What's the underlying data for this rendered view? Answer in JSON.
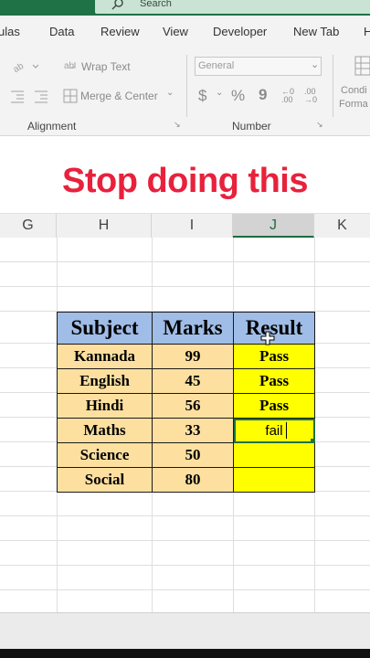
{
  "search": {
    "placeholder": "Search"
  },
  "tabs": [
    {
      "label": "ulas"
    },
    {
      "label": "Data"
    },
    {
      "label": "Review"
    },
    {
      "label": "View"
    },
    {
      "label": "Developer"
    },
    {
      "label": "New Tab"
    },
    {
      "label": "H"
    }
  ],
  "ribbon": {
    "wrap_text": "Wrap Text",
    "merge_center": "Merge & Center",
    "number_format": "General",
    "currency": "$",
    "percent": "%",
    "comma": "9",
    "inc_decimal": "←0 .00",
    "dec_decimal": ".00 →0",
    "cond_format_line1": "Condi",
    "cond_format_line2": "Forma",
    "group_alignment": "Alignment",
    "group_number": "Number"
  },
  "heading": "Stop doing this",
  "columns": [
    "G",
    "H",
    "I",
    "J",
    "K"
  ],
  "table": {
    "headers": [
      "Subject",
      "Marks",
      "Result"
    ],
    "rows": [
      [
        "Kannada",
        "99",
        "Pass"
      ],
      [
        "English",
        "45",
        "Pass"
      ],
      [
        "Hindi",
        "56",
        "Pass"
      ],
      [
        "Maths",
        "33",
        "fail"
      ],
      [
        "Science",
        "50",
        ""
      ],
      [
        "Social",
        "80",
        ""
      ]
    ]
  },
  "colors": {
    "excel_green": "#1e7145",
    "heading_red": "#e8213c",
    "header_blue": "#9fbde6",
    "cell_orange": "#fde0a0",
    "cell_yellow": "#ffff00"
  }
}
